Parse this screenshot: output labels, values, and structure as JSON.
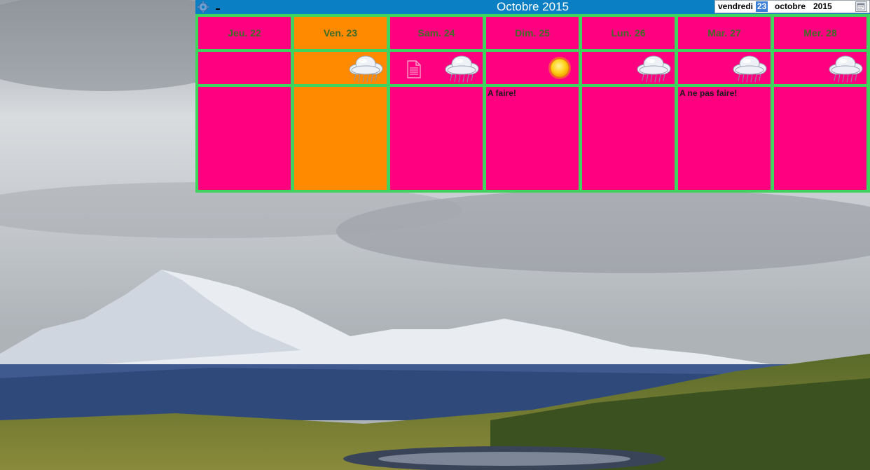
{
  "widget": {
    "title": "Octobre 2015",
    "datepicker": {
      "weekday": "vendredi",
      "day": "23",
      "month": "octobre",
      "year": "2015"
    }
  },
  "days": [
    {
      "label": "Jeu. 22",
      "today": false,
      "weather": "none",
      "has_note_icon": false,
      "note": ""
    },
    {
      "label": "Ven. 23",
      "today": true,
      "weather": "rain-cloud-icon",
      "has_note_icon": false,
      "note": ""
    },
    {
      "label": "Sam. 24",
      "today": false,
      "weather": "rain-cloud-icon",
      "has_note_icon": true,
      "note": ""
    },
    {
      "label": "Dim. 25",
      "today": false,
      "weather": "sun-icon",
      "has_note_icon": false,
      "note": "A faire!"
    },
    {
      "label": "Lun. 26",
      "today": false,
      "weather": "rain-cloud-icon",
      "has_note_icon": false,
      "note": ""
    },
    {
      "label": "Mar. 27",
      "today": false,
      "weather": "rain-cloud-icon",
      "has_note_icon": false,
      "note": "A ne pas faire!"
    },
    {
      "label": "Mer. 28",
      "today": false,
      "weather": "rain-cloud-icon",
      "has_note_icon": false,
      "note": ""
    }
  ],
  "colors": {
    "titlebar": "#0b7fc4",
    "cell_default": "#ff0080",
    "cell_today": "#ff8a00",
    "grid_lines": "#3ed45e",
    "day_label": "#3f6b26"
  }
}
